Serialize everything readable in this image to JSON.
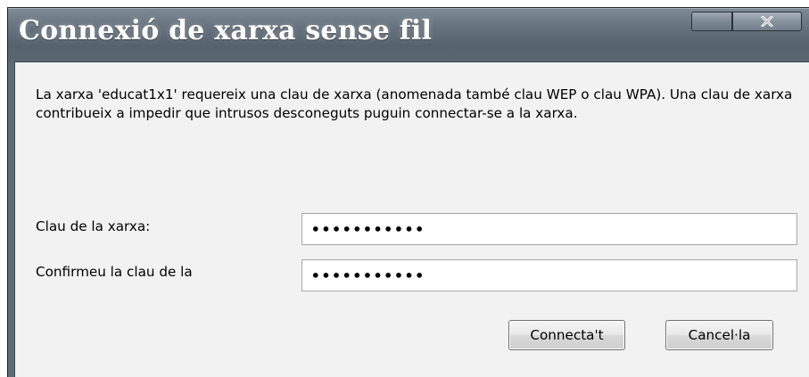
{
  "window": {
    "title": "Connexió de xarxa sense fil",
    "close_icon": "close-icon"
  },
  "dialog": {
    "description": "La xarxa 'educat1x1' requereix una clau de xarxa (anomenada també clau WEP o clau WPA). Una clau de xarxa contribueix a impedir que intrusos desconeguts puguin connectar-se a la xarxa.",
    "network_key": {
      "label": "Clau de la xarxa:",
      "value": "ccccccccccc",
      "masked_display": "•••••••••••"
    },
    "confirm_key": {
      "label": "Confirmeu la clau de la",
      "value": "ccccccccccc",
      "masked_display": "•••••••••••"
    },
    "buttons": {
      "connect": "Connecta't",
      "cancel": "Cancel·la"
    }
  },
  "colors": {
    "titlebar": "#66727e",
    "content_background": "#f2f2f2"
  }
}
